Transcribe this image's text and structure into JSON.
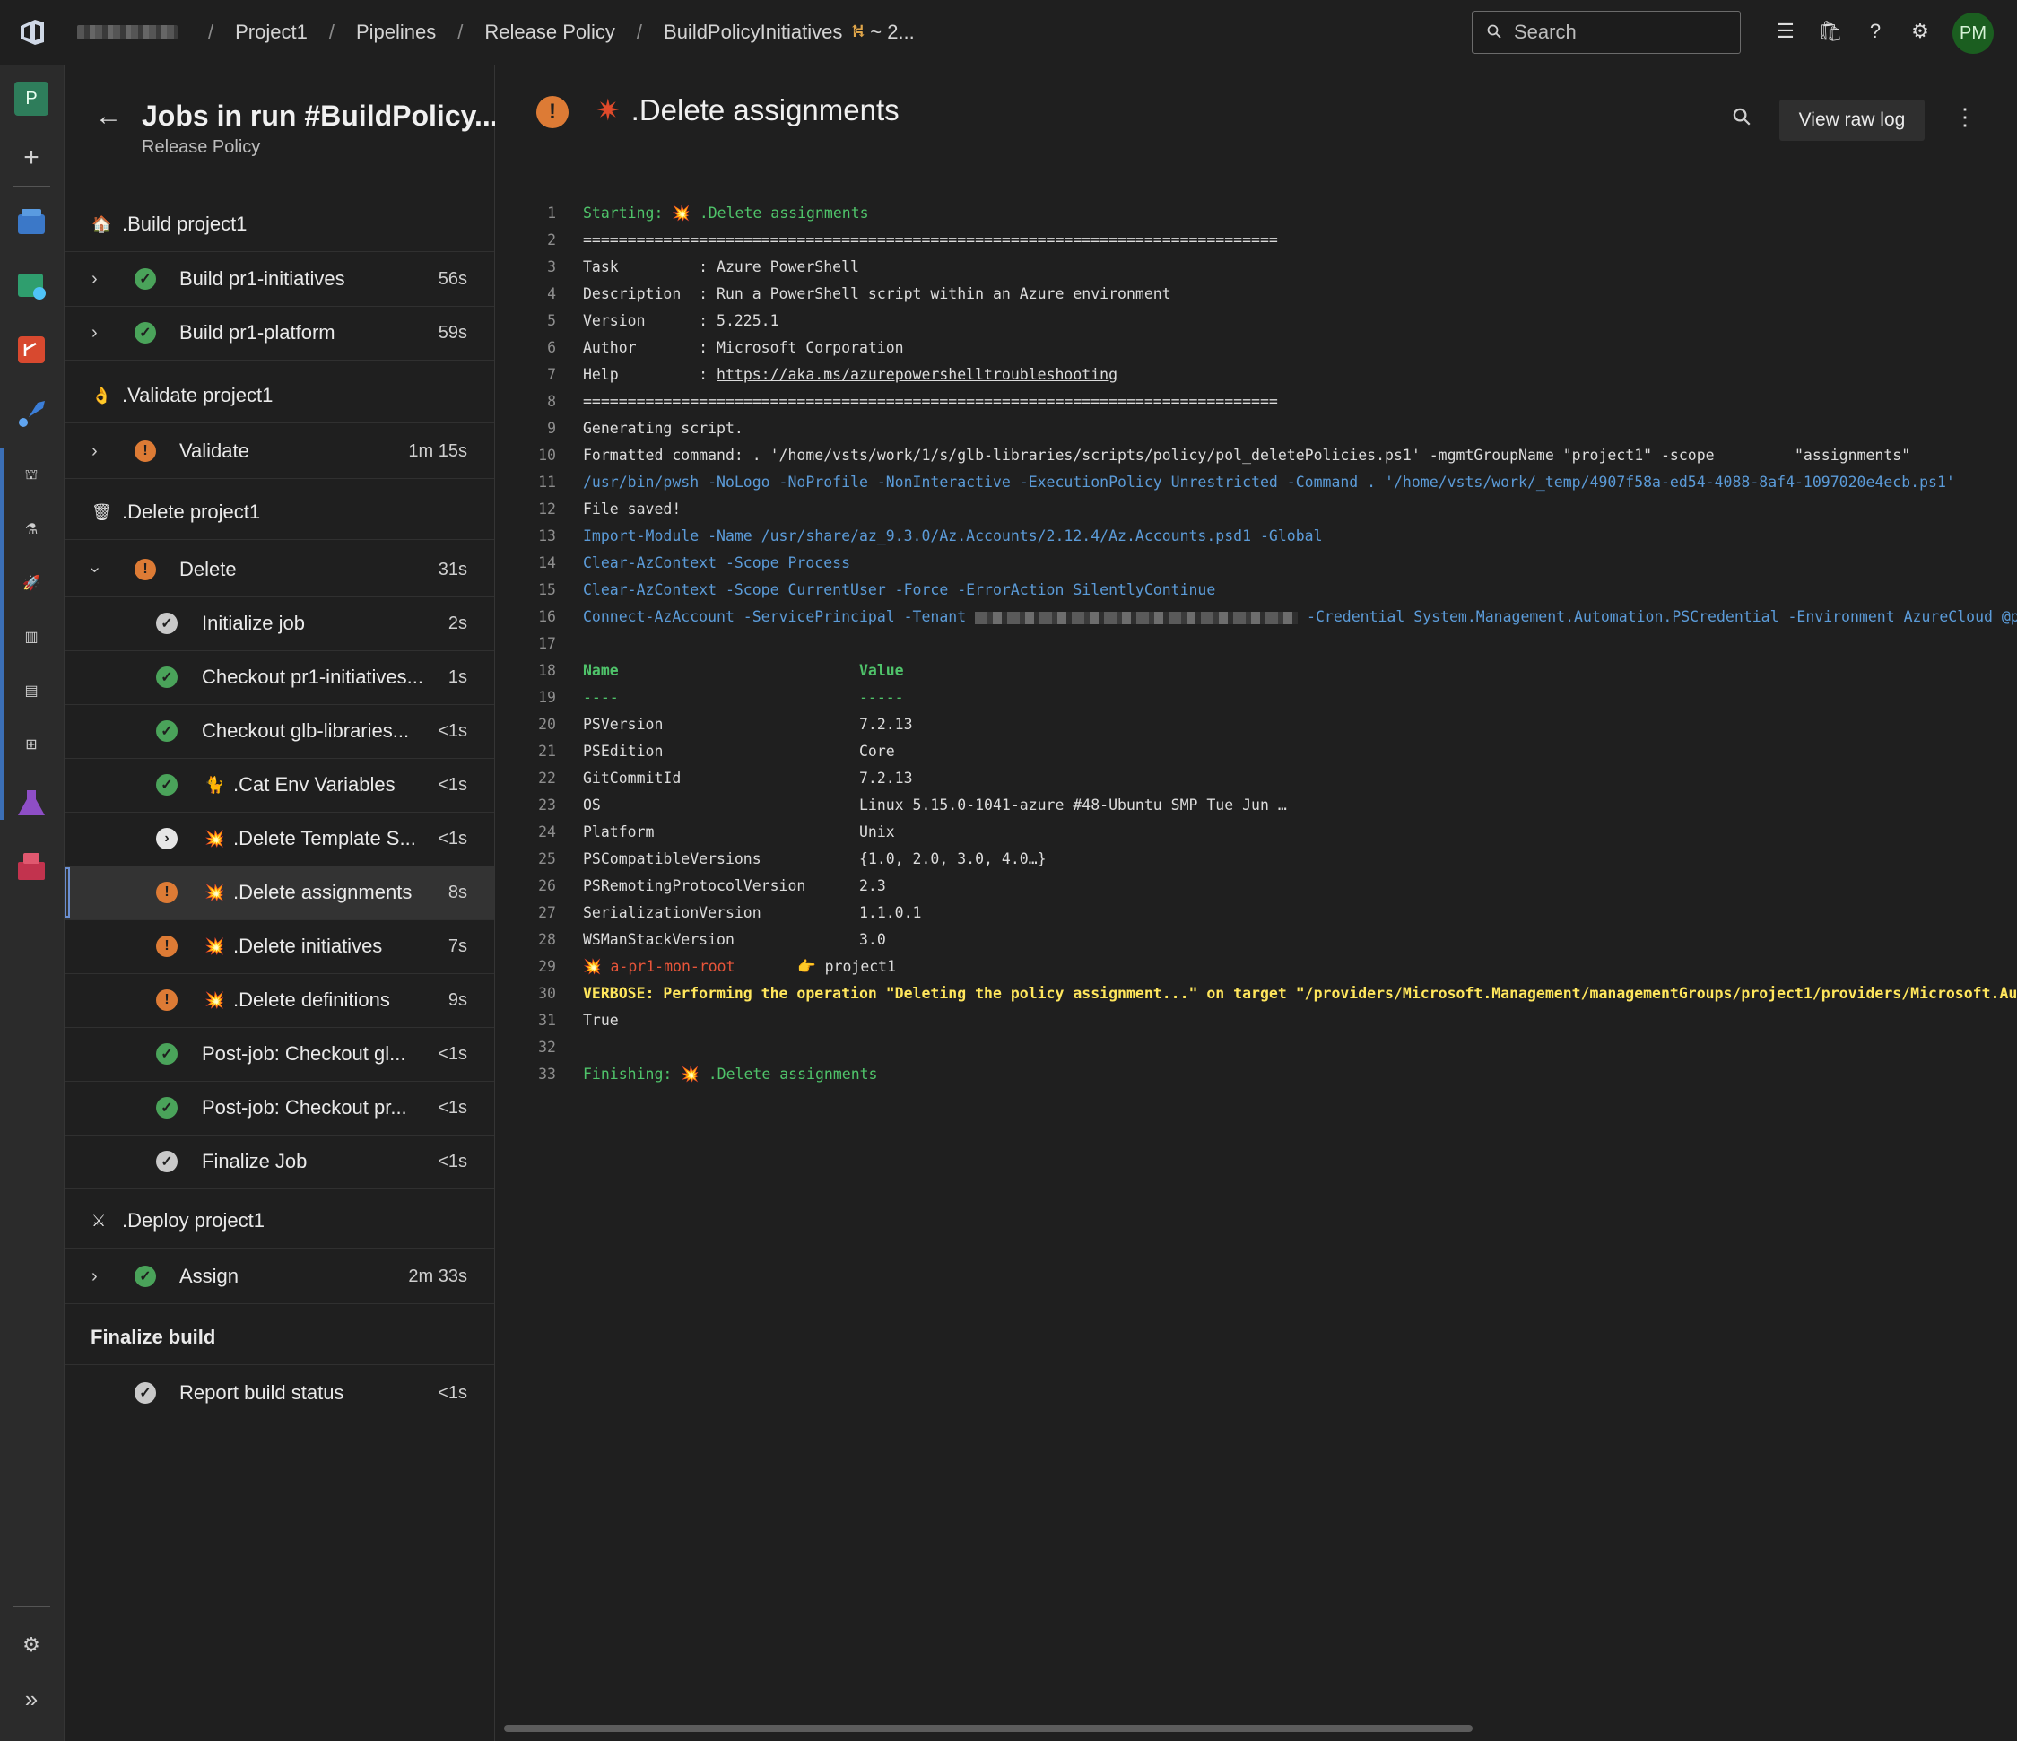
{
  "topbar": {
    "breadcrumbs": [
      "Project1",
      "Pipelines",
      "Release Policy",
      "BuildPolicyInitiatives"
    ],
    "run_suffix": "~ 2...",
    "search_placeholder": "Search",
    "avatar_initials": "PM"
  },
  "rail": {
    "project_initial": "P"
  },
  "jobs_panel": {
    "title": "Jobs in run #BuildPolicy...",
    "subtitle": "Release Policy",
    "stages": [
      {
        "label": ".Build project1",
        "icon": "🏠"
      },
      {
        "label": ".Validate project1",
        "icon": "👌"
      },
      {
        "label": ".Delete project1",
        "icon": "🗑"
      },
      {
        "label": ".Deploy project1",
        "icon": "⚔"
      },
      {
        "label": "Finalize build"
      }
    ],
    "jobs": [
      {
        "label": "Build pr1-initiatives",
        "duration": "56s",
        "status": "success"
      },
      {
        "label": "Build pr1-platform",
        "duration": "59s",
        "status": "success"
      },
      {
        "label": "Validate",
        "duration": "1m 15s",
        "status": "warning"
      },
      {
        "label": "Delete",
        "duration": "31s",
        "status": "warning"
      },
      {
        "label": "Assign",
        "duration": "2m 33s",
        "status": "success"
      },
      {
        "label": "Report build status",
        "duration": "<1s",
        "status": "completed"
      }
    ],
    "steps": [
      {
        "label": "Initialize job",
        "duration": "2s",
        "status": "completed"
      },
      {
        "label": "Checkout pr1-initiatives...",
        "duration": "1s",
        "status": "success"
      },
      {
        "label": "Checkout glb-libraries...",
        "duration": "<1s",
        "status": "success"
      },
      {
        "label": ".Cat Env Variables",
        "duration": "<1s",
        "status": "success",
        "emoji": "🐈"
      },
      {
        "label": ".Delete Template S...",
        "duration": "<1s",
        "status": "skipped",
        "emoji": "💥"
      },
      {
        "label": ".Delete assignments",
        "duration": "8s",
        "status": "warning",
        "emoji": "💥"
      },
      {
        "label": ".Delete initiatives",
        "duration": "7s",
        "status": "warning",
        "emoji": "💥"
      },
      {
        "label": ".Delete definitions",
        "duration": "9s",
        "status": "warning",
        "emoji": "💥"
      },
      {
        "label": "Post-job: Checkout gl...",
        "duration": "<1s",
        "status": "success"
      },
      {
        "label": "Post-job: Checkout pr...",
        "duration": "<1s",
        "status": "success"
      },
      {
        "label": "Finalize Job",
        "duration": "<1s",
        "status": "completed"
      }
    ]
  },
  "log": {
    "title": ".Delete assignments",
    "view_raw_label": "View raw log",
    "lines": [
      {
        "n": "1",
        "text": "Starting: 💥 .Delete assignments",
        "color": "green"
      },
      {
        "n": "2",
        "text": "==============================================================================",
        "color": "white"
      },
      {
        "n": "3",
        "text": "Task         : Azure PowerShell",
        "color": "white"
      },
      {
        "n": "4",
        "text": "Description  : Run a PowerShell script within an Azure environment",
        "color": "white"
      },
      {
        "n": "5",
        "text": "Version      : 5.225.1",
        "color": "white"
      },
      {
        "n": "6",
        "text": "Author       : Microsoft Corporation",
        "color": "white"
      },
      {
        "n": "7",
        "text": "Help         : ",
        "link": "https://aka.ms/azurepowershelltroubleshooting",
        "color": "white"
      },
      {
        "n": "8",
        "text": "==============================================================================",
        "color": "white"
      },
      {
        "n": "9",
        "text": "Generating script.",
        "color": "white"
      },
      {
        "n": "10",
        "text": "Formatted command: . '/home/vsts/work/1/s/glb-libraries/scripts/policy/pol_deletePolicies.ps1' -mgmtGroupName \"project1\" -scope         \"assignments\"",
        "color": "white"
      },
      {
        "n": "11",
        "text": "/usr/bin/pwsh -NoLogo -NoProfile -NonInteractive -ExecutionPolicy Unrestricted -Command . '/home/vsts/work/_temp/4907f58a-ed54-4088-8af4-1097020e4ecb.ps1'",
        "color": "blue"
      },
      {
        "n": "12",
        "text": "File saved!",
        "color": "white"
      },
      {
        "n": "13",
        "text": "Import-Module -Name /usr/share/az_9.3.0/Az.Accounts/2.12.4/Az.Accounts.psd1 -Global",
        "color": "blue"
      },
      {
        "n": "14",
        "text": "Clear-AzContext -Scope Process",
        "color": "blue"
      },
      {
        "n": "15",
        "text": "Clear-AzContext -Scope CurrentUser -Force -ErrorAction SilentlyContinue",
        "color": "blue"
      },
      {
        "n": "16",
        "text": "Connect-AzAccount -ServicePrincipal -Tenant ",
        "redacted": true,
        "text_after": " -Credential System.Management.Automation.PSCredential -Environment AzureCloud @pr",
        "color": "blue"
      },
      {
        "n": "17",
        "text": "",
        "color": "white"
      },
      {
        "n": "18",
        "text": "Name                           Value",
        "color": "greenbold"
      },
      {
        "n": "19",
        "text": "----                           -----",
        "color": "green"
      },
      {
        "n": "20",
        "text": "PSVersion                      7.2.13",
        "color": "white"
      },
      {
        "n": "21",
        "text": "PSEdition                      Core",
        "color": "white"
      },
      {
        "n": "22",
        "text": "GitCommitId                    7.2.13",
        "color": "white"
      },
      {
        "n": "23",
        "text": "OS                             Linux 5.15.0-1041-azure #48-Ubuntu SMP Tue Jun …",
        "color": "white"
      },
      {
        "n": "24",
        "text": "Platform                       Unix",
        "color": "white"
      },
      {
        "n": "25",
        "text": "PSCompatibleVersions           {1.0, 2.0, 3.0, 4.0…}",
        "color": "white"
      },
      {
        "n": "26",
        "text": "PSRemotingProtocolVersion      2.3",
        "color": "white"
      },
      {
        "n": "27",
        "text": "SerializationVersion           1.1.0.1",
        "color": "white"
      },
      {
        "n": "28",
        "text": "WSManStackVersion              3.0",
        "color": "white"
      },
      {
        "n": "29",
        "text": "💥 a-pr1-mon-root",
        "text_after": "       👉 project1",
        "color": "red"
      },
      {
        "n": "30",
        "text": "VERBOSE: Performing the operation \"Deleting the policy assignment...\" on target \"/providers/Microsoft.Management/managementGroups/project1/providers/Microsoft.Aut",
        "color": "yellow"
      },
      {
        "n": "31",
        "text": "True",
        "color": "white"
      },
      {
        "n": "32",
        "text": "",
        "color": "white"
      },
      {
        "n": "33",
        "text": "Finishing: 💥 .Delete assignments",
        "color": "green"
      }
    ]
  },
  "colors": {
    "success": "#4aa35a",
    "warning": "#dd7b35",
    "accent": "#3b6fb6",
    "log_green": "#4fc36a",
    "log_blue": "#5b9bd8",
    "log_yellow": "#ffe65c"
  }
}
